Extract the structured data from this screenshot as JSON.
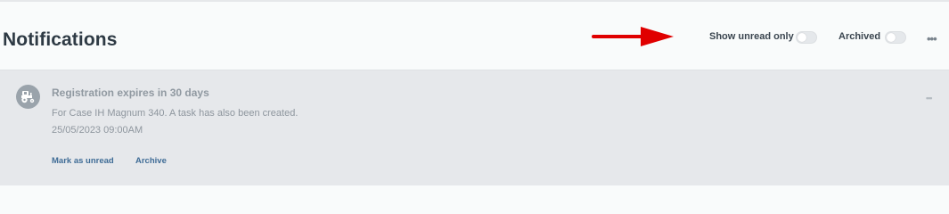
{
  "header": {
    "title": "Notifications",
    "show_unread_label": "Show unread only",
    "show_unread_on": false,
    "archived_label": "Archived",
    "archived_on": false,
    "more_label": "•••"
  },
  "notification": {
    "icon": "tractor-icon",
    "title": "Registration expires in 30 days",
    "body": "For Case IH Magnum 340. A task has also been created.",
    "date": "25/05/2023 09:00AM",
    "more_label": "•••",
    "actions": {
      "mark_unread": "Mark as unread",
      "archive": "Archive"
    }
  },
  "colors": {
    "arrow": "#e00000",
    "link": "#3f6c96",
    "card_bg": "#e6e8eb"
  }
}
